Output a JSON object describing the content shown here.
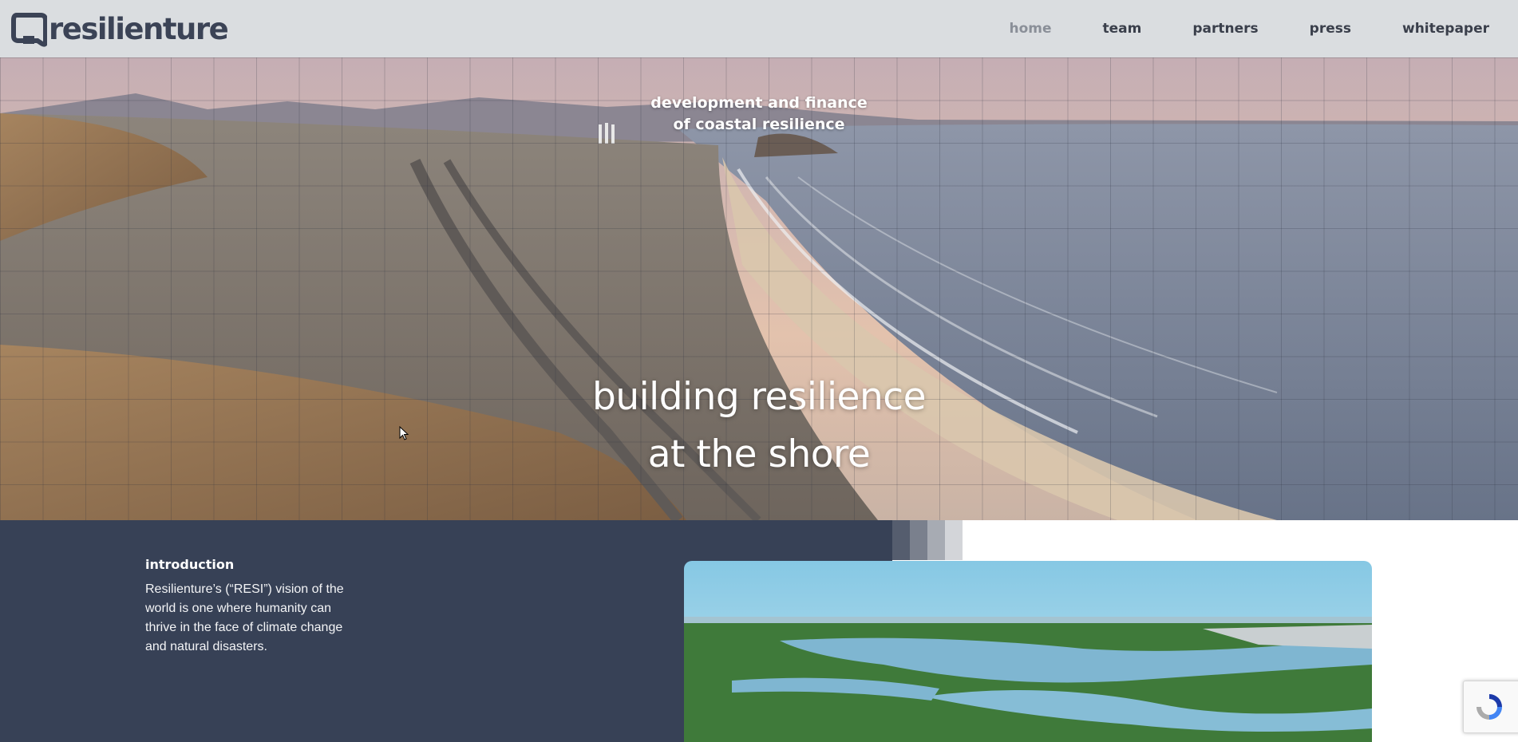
{
  "brand": {
    "logo_text": "resilienture"
  },
  "nav": {
    "items": [
      {
        "label": "home",
        "active": true
      },
      {
        "label": "team",
        "active": false
      },
      {
        "label": "partners",
        "active": false
      },
      {
        "label": "press",
        "active": false
      },
      {
        "label": "whitepaper",
        "active": false
      }
    ]
  },
  "hero": {
    "tagline_line1": "development and finance",
    "tagline_line2": "of coastal resilience",
    "headline_line1": "building resilience",
    "headline_line2": "at the shore"
  },
  "intro": {
    "title": "introduction",
    "body": "Resilienture’s (“RESI”) vision of the world is one where humanity can thrive in the face of climate change and natural disasters."
  },
  "colors": {
    "header_bg": "#dadde0",
    "brand_text": "#3b4356",
    "section_bg": "#374156",
    "nav_active": "#8a8f98"
  }
}
